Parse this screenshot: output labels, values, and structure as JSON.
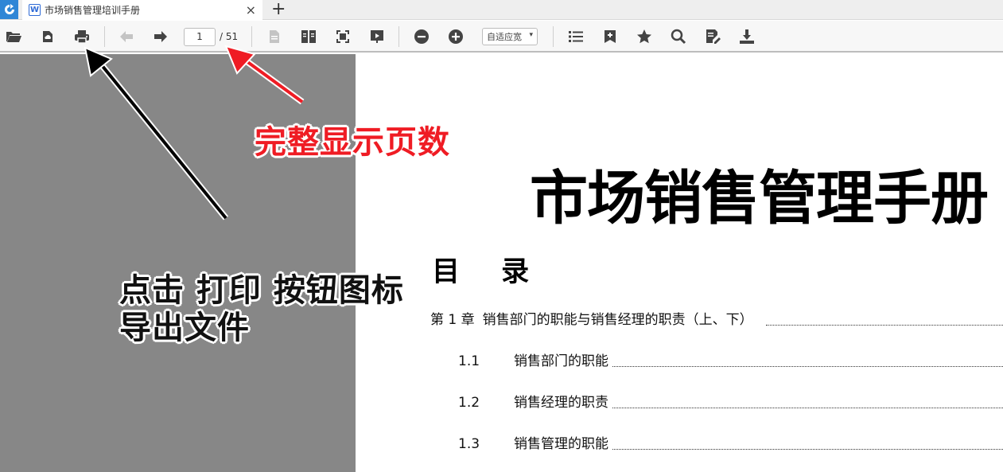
{
  "window": {
    "tab_title": "市场销售管理培训手册",
    "tab_close": "×",
    "new_tab": "+"
  },
  "toolbar": {
    "icons": [
      "open-folder-icon",
      "cloud-upload-icon",
      "print-icon",
      "previous-page-icon",
      "next-page-icon",
      "single-page-icon",
      "two-page-icon",
      "fit-screen-icon",
      "presentation-icon",
      "zoom-out-icon",
      "zoom-in-icon",
      "outline-list-icon",
      "add-bookmark-icon",
      "favorite-star-icon",
      "search-icon",
      "annotate-icon",
      "download-icon"
    ],
    "current_page": "1",
    "total_pages": "/ 51",
    "zoom_mode": "自适应宽",
    "zoom_caret": "▾"
  },
  "document": {
    "title": "市场销售管理手册",
    "toc_heading": "目 录",
    "toc": [
      {
        "number": "第 1 章",
        "text": "销售部门的职能与销售经理的职责（上、下）"
      },
      {
        "number": "1.1",
        "text": "销售部门的职能"
      },
      {
        "number": "1.2",
        "text": "销售经理的职责"
      },
      {
        "number": "1.3",
        "text": "销售管理的职能"
      }
    ]
  },
  "annotations": {
    "page_count_note": "完整显示页数",
    "print_note_line1": "点击 打印 按钮图标",
    "print_note_line2": "导出文件"
  },
  "colors": {
    "accent_blue": "#2f86d6",
    "annotation_red": "#ef1c24",
    "sidebar_gray": "#878787",
    "toolbar_bg": "#f7f7f7"
  }
}
